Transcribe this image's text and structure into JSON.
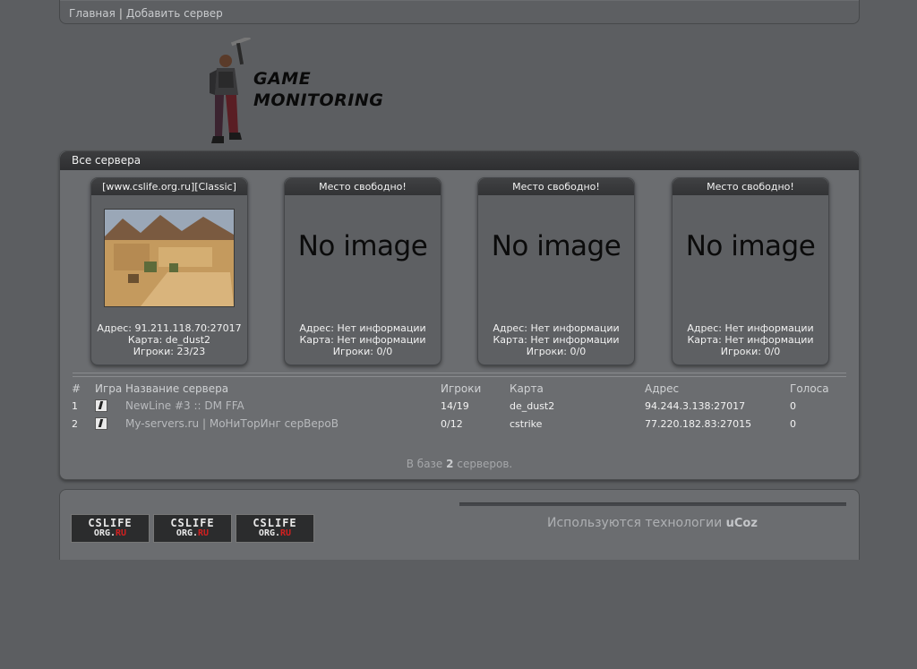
{
  "nav": {
    "home": "Главная",
    "separator": "|",
    "add_server": "Добавить сервер"
  },
  "logo": {
    "line1": "GAME",
    "line2": "MONITORING"
  },
  "panel": {
    "title": "Все сервера"
  },
  "cards": [
    {
      "title": "[www.cslife.org.ru][Classic]",
      "address": "Адрес: 91.211.118.70:27017",
      "map": "Карта: de_dust2",
      "players": "Игроки: 23/23"
    },
    {
      "title": "Место свободно!",
      "image_text": "No image",
      "address": "Адрес: Нет информации",
      "map": "Карта: Нет информации",
      "players": "Игроки: 0/0"
    },
    {
      "title": "Место свободно!",
      "image_text": "No image",
      "address": "Адрес: Нет информации",
      "map": "Карта: Нет информации",
      "players": "Игроки: 0/0"
    },
    {
      "title": "Место свободно!",
      "image_text": "No image",
      "address": "Адрес: Нет информации",
      "map": "Карта: Нет информации",
      "players": "Игроки: 0/0"
    }
  ],
  "table": {
    "headers": [
      "#",
      "Игра",
      "Название сервера",
      "Игроки",
      "Карта",
      "Адрес",
      "Голоса"
    ],
    "rows": [
      {
        "num": "1",
        "game_icon": "cs-icon",
        "name": "NewLine #3 :: DM FFA",
        "players": "14/19",
        "map": "de_dust2",
        "address": "94.244.3.138:27017",
        "votes": "0"
      },
      {
        "num": "2",
        "game_icon": "cs-icon",
        "name": "My-servers.ru | МоНиТорИнг серВероВ",
        "players": "0/12",
        "map": "cstrike",
        "address": "77.220.182.83:27015",
        "votes": "0"
      }
    ]
  },
  "summary": {
    "prefix": "В базе",
    "count": "2",
    "suffix": "серверов."
  },
  "banners": [
    {
      "top": "CSLIFE",
      "bottom_a": "ORG.",
      "bottom_b": "RU"
    },
    {
      "top": "CSLIFE",
      "bottom_a": "ORG.",
      "bottom_b": "RU"
    },
    {
      "top": "CSLIFE",
      "bottom_a": "ORG.",
      "bottom_b": "RU"
    }
  ],
  "footer": {
    "tech_text": "Используются технологии",
    "tech_brand": "uCoz"
  }
}
